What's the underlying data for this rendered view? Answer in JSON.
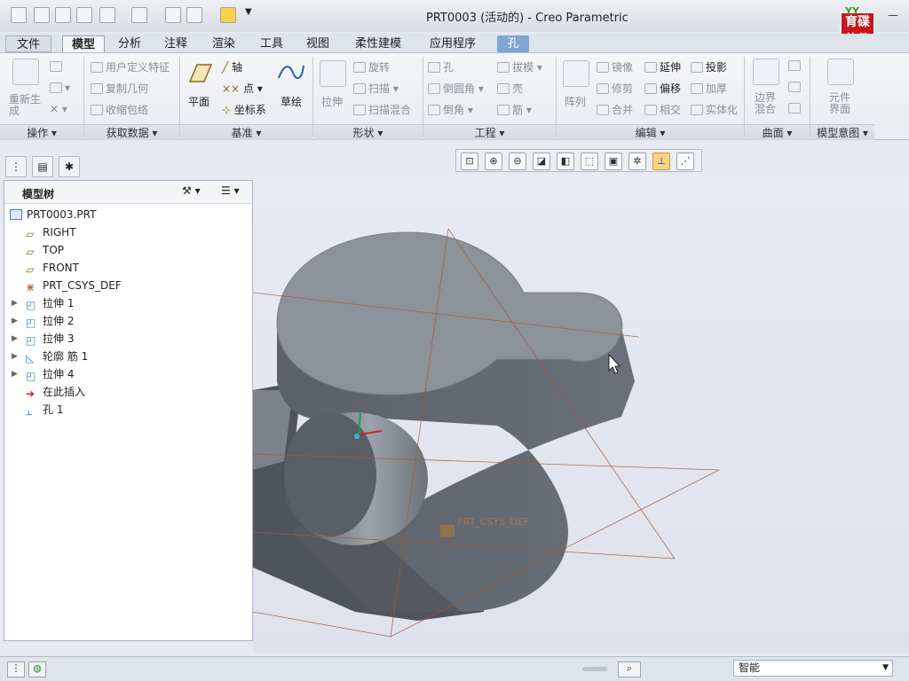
{
  "window": {
    "title": "PRT0003 (活动的) - Creo Parametric",
    "min_label": "—",
    "close_label": "✕",
    "help_label": "?"
  },
  "logo": {
    "top": "YY",
    "line1": "育碟",
    "line2": "软件"
  },
  "menu_tabs": [
    "文件",
    "模型",
    "分析",
    "注释",
    "渲染",
    "工具",
    "视图",
    "柔性建模",
    "应用程序",
    "孔"
  ],
  "ribbon": {
    "regen_label": "重新生成",
    "udf": "用户定义特征",
    "copy_geom": "复制几何",
    "shrinkwrap": "收缩包络",
    "plane": "平面",
    "axis": "轴",
    "point": "点",
    "csys": "坐标系",
    "sketch": "草绘",
    "extrude": "拉伸",
    "revolve": "旋转",
    "sweep": "扫描",
    "swept_blend": "扫描混合",
    "hole": "孔",
    "round": "倒圆角",
    "chamfer": "倒角",
    "draft": "拔模",
    "shell": "壳",
    "rib": "筋",
    "pattern": "阵列",
    "mirror": "镜像",
    "extend": "延伸",
    "project": "投影",
    "trim": "修剪",
    "offset": "偏移",
    "thicken": "加厚",
    "merge": "合并",
    "intersect": "相交",
    "solidify": "实体化",
    "boundary_blend": "边界混合",
    "component_interface": "元件界面"
  },
  "groups": [
    "操作",
    "获取数据",
    "基准",
    "形状",
    "工程",
    "编辑",
    "曲面",
    "模型意图"
  ],
  "model_tree": {
    "header": "模型树",
    "root": "PRT0003.PRT",
    "nodes": [
      "RIGHT",
      "TOP",
      "FRONT",
      "PRT_CSYS_DEF",
      "拉伸 1",
      "拉伸 2",
      "拉伸 3",
      "轮廓 筋 1",
      "拉伸 4",
      "在此插入",
      "孔 1"
    ]
  },
  "canvas": {
    "csys_label": "PRT_CSYS_DEF"
  },
  "status": {
    "filter_value": "智能"
  }
}
